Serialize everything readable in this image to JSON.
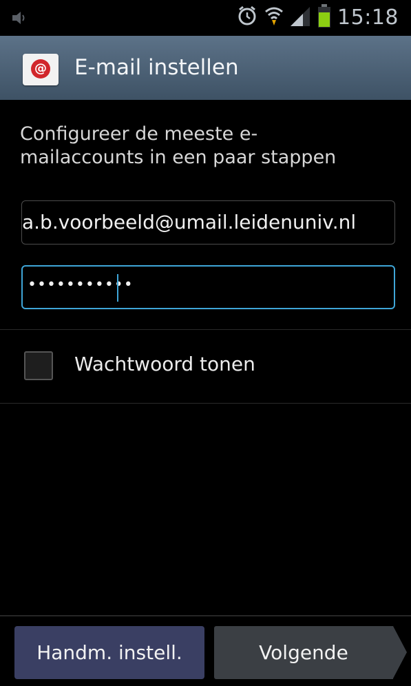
{
  "status_bar": {
    "time": "15:18",
    "icons": [
      "volume-icon",
      "alarm-icon",
      "wifi-icon",
      "signal-icon",
      "battery-icon"
    ]
  },
  "action_bar": {
    "title": "E-mail instellen",
    "icon": "email-app-icon"
  },
  "intro_text": "Configureer de meeste e-mailaccounts in een paar stappen",
  "email_field": {
    "value": "a.b.voorbeeld@umail.leidenuniv.nl"
  },
  "password_field": {
    "masked_value": "•••••••••••"
  },
  "show_password": {
    "label": "Wachtwoord tonen",
    "checked": false
  },
  "buttons": {
    "manual": "Handm. instell.",
    "next": "Volgende"
  },
  "colors": {
    "action_bar": "#4e6377",
    "focus_accent": "#3fa6d8",
    "manual_button": "#3a3f63",
    "next_button": "#3b3f44"
  }
}
